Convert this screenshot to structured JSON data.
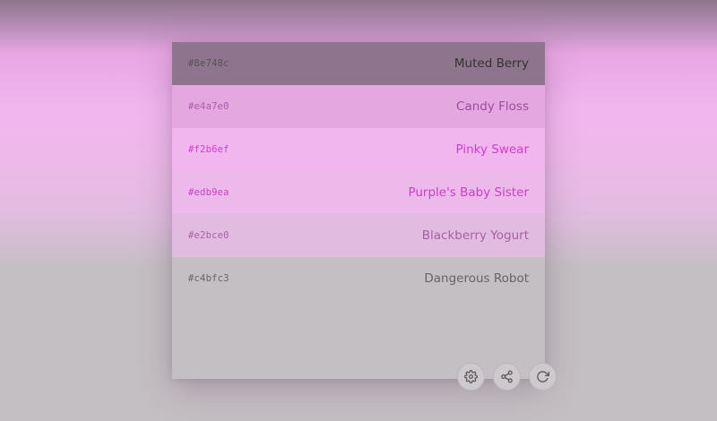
{
  "swatches": [
    {
      "hex": "#8e748c",
      "name": "Muted Berry",
      "bg": "#8e748c",
      "text_color": "#333333",
      "hex_color": "#555555"
    },
    {
      "hex": "#e4a7e0",
      "name": "Candy Floss",
      "bg": "#e4a7e0",
      "text_color": "#a04aa0",
      "hex_color": "#b05ab0"
    },
    {
      "hex": "#f2b6ef",
      "name": "Pinky Swear",
      "bg": "#f2b6ef",
      "text_color": "#d23ccd",
      "hex_color": "#d23ccd"
    },
    {
      "hex": "#edb9ea",
      "name": "Purple's Baby Sister",
      "bg": "#edb9ea",
      "text_color": "#c940c4",
      "hex_color": "#c940c4"
    },
    {
      "hex": "#e2bce0",
      "name": "Blackberry Yogurt",
      "bg": "#e2bce0",
      "text_color": "#a562a2",
      "hex_color": "#a562a2"
    },
    {
      "hex": "#c4bfc3",
      "name": "Dangerous Robot",
      "bg": "#c4bfc3",
      "text_color": "#666666",
      "hex_color": "#666666"
    }
  ],
  "toolbar": {
    "buttons": [
      {
        "icon": "gear-icon",
        "action": "settings"
      },
      {
        "icon": "share-icon",
        "action": "share"
      },
      {
        "icon": "refresh-icon",
        "action": "refresh"
      }
    ]
  },
  "colors": {
    "icon_stroke": "#555555"
  }
}
